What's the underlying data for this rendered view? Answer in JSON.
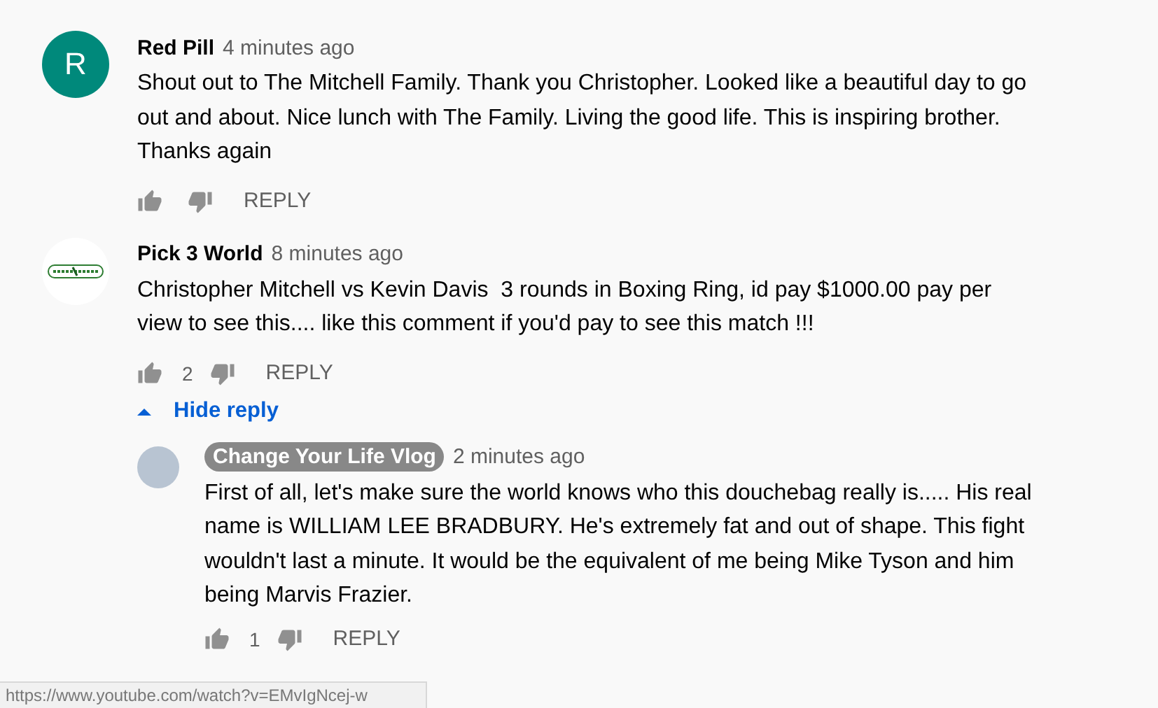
{
  "comments": [
    {
      "author": "Red Pill",
      "owner": false,
      "avatar": {
        "kind": "letter",
        "letter": "R",
        "color": "#00897b"
      },
      "time": "4 minutes ago",
      "text": "Shout out to The Mitchell Family. Thank you Christopher. Looked like a beautiful day to go out and about. Nice lunch with The Family. Living the good life. This is inspiring brother. Thanks again",
      "reply_label": "REPLY"
    },
    {
      "author": "Pick 3 World",
      "owner": false,
      "avatar": {
        "kind": "logo"
      },
      "time": "8 minutes ago",
      "text": "Christopher Mitchell vs Kevin Davis  3 rounds in Boxing Ring, id pay $1000.00 pay per view to see this.... like this comment if you'd pay to see this match !!!",
      "likes": "2",
      "reply_label": "REPLY",
      "replies_toggle": {
        "label": "Hide reply",
        "expanded": true
      },
      "replies": [
        {
          "author": "Change Your Life Vlog",
          "owner": true,
          "avatar": {
            "kind": "photo"
          },
          "time": "2 minutes ago",
          "text": "First of all, let's make sure the world knows who this douchebag really is..... His real name is WILLIAM LEE BRADBURY. He's extremely fat and out of shape. This fight wouldn't last a minute. It would be the equivalent of me being Mike Tyson and him being Marvis Frazier.",
          "likes": "1",
          "reply_label": "REPLY"
        }
      ]
    }
  ],
  "status_bar": {
    "url": "https://www.youtube.com/watch?v=EMvIgNcej-w"
  }
}
